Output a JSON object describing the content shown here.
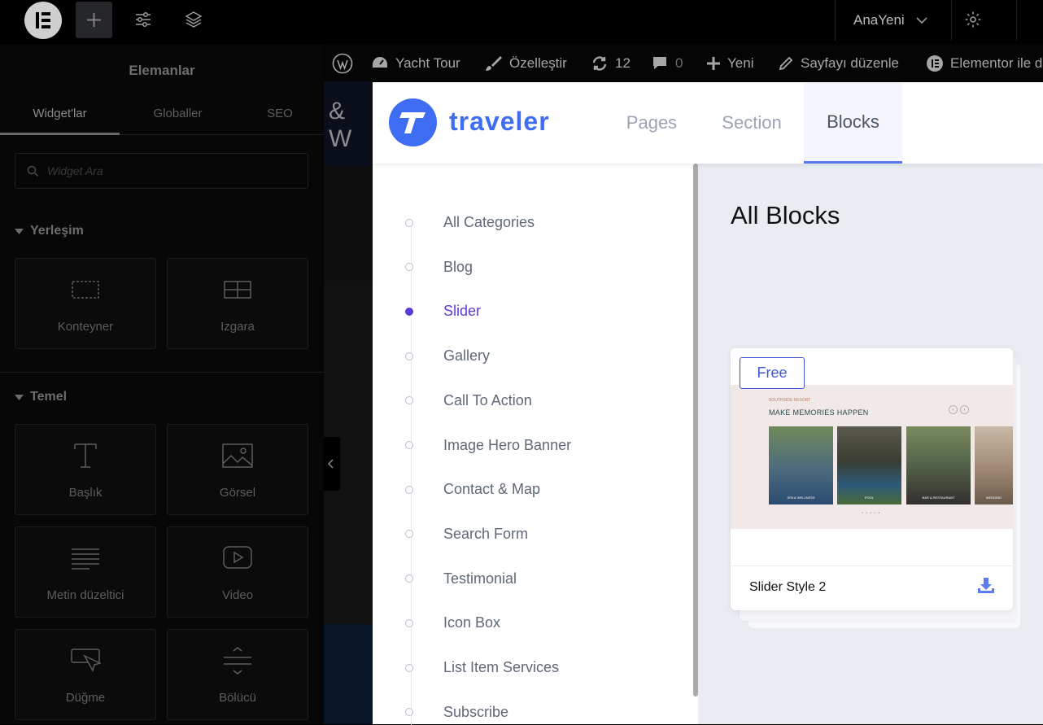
{
  "colors": {
    "accent": "#3e6df3",
    "active_category": "#5b3bd6",
    "badge": "#3e56d8"
  },
  "topbar": {
    "page_name": "AnaYeni",
    "icons": [
      "elementor-logo-icon",
      "plus-icon",
      "sliders-icon",
      "layers-icon",
      "chevron-down-icon",
      "gear-icon"
    ]
  },
  "panel": {
    "title": "Elemanlar",
    "tabs": [
      {
        "label": "Widget'lar",
        "active": true
      },
      {
        "label": "Globaller",
        "active": false
      },
      {
        "label": "SEO",
        "active": false
      }
    ],
    "search_placeholder": "Widget Ara",
    "sections": [
      {
        "title": "Yerleşim",
        "widgets": [
          {
            "label": "Konteyner",
            "icon": "container-icon"
          },
          {
            "label": "Izgara",
            "icon": "grid-icon"
          }
        ]
      },
      {
        "title": "Temel",
        "widgets": [
          {
            "label": "Başlık",
            "icon": "heading-icon"
          },
          {
            "label": "Görsel",
            "icon": "image-icon"
          },
          {
            "label": "Metin düzeltici",
            "icon": "text-editor-icon"
          },
          {
            "label": "Video",
            "icon": "video-icon"
          },
          {
            "label": "Düğme",
            "icon": "button-icon"
          },
          {
            "label": "Bölücü",
            "icon": "divider-icon"
          }
        ]
      }
    ]
  },
  "wp_bar": {
    "site": "Yacht Tour",
    "customize": "Özelleştir",
    "updates": "12",
    "comments": "0",
    "new": "Yeni",
    "edit_page": "Sayfayı düzenle",
    "elementor": "Elementor ile d"
  },
  "preview": {
    "heading_fragment": "& W"
  },
  "modal": {
    "brand": "traveler",
    "tabs": [
      {
        "label": "Pages",
        "active": false
      },
      {
        "label": "Section",
        "active": false
      },
      {
        "label": "Blocks",
        "active": true
      }
    ],
    "categories": [
      {
        "label": "All Categories",
        "active": false
      },
      {
        "label": "Blog",
        "active": false
      },
      {
        "label": "Slider",
        "active": true
      },
      {
        "label": "Gallery",
        "active": false
      },
      {
        "label": "Call To Action",
        "active": false
      },
      {
        "label": "Image Hero Banner",
        "active": false
      },
      {
        "label": "Contact & Map",
        "active": false
      },
      {
        "label": "Search Form",
        "active": false
      },
      {
        "label": "Testimonial",
        "active": false
      },
      {
        "label": "Icon Box",
        "active": false
      },
      {
        "label": "List Item Services",
        "active": false
      },
      {
        "label": "Subscribe",
        "active": false
      }
    ],
    "content_title": "All Blocks",
    "blocks": [
      {
        "badge": "Free",
        "name": "Slider Style 2",
        "thumbnail": {
          "kicker": "SOUTHSIDE RESORT",
          "title": "MAKE MEMORIES HAPPEN",
          "images": [
            {
              "caption": "SPA & WELLNESS"
            },
            {
              "caption": "POOL"
            },
            {
              "caption": "BAR & RESTAURANT"
            },
            {
              "caption": "WEDDING"
            }
          ]
        }
      }
    ]
  }
}
